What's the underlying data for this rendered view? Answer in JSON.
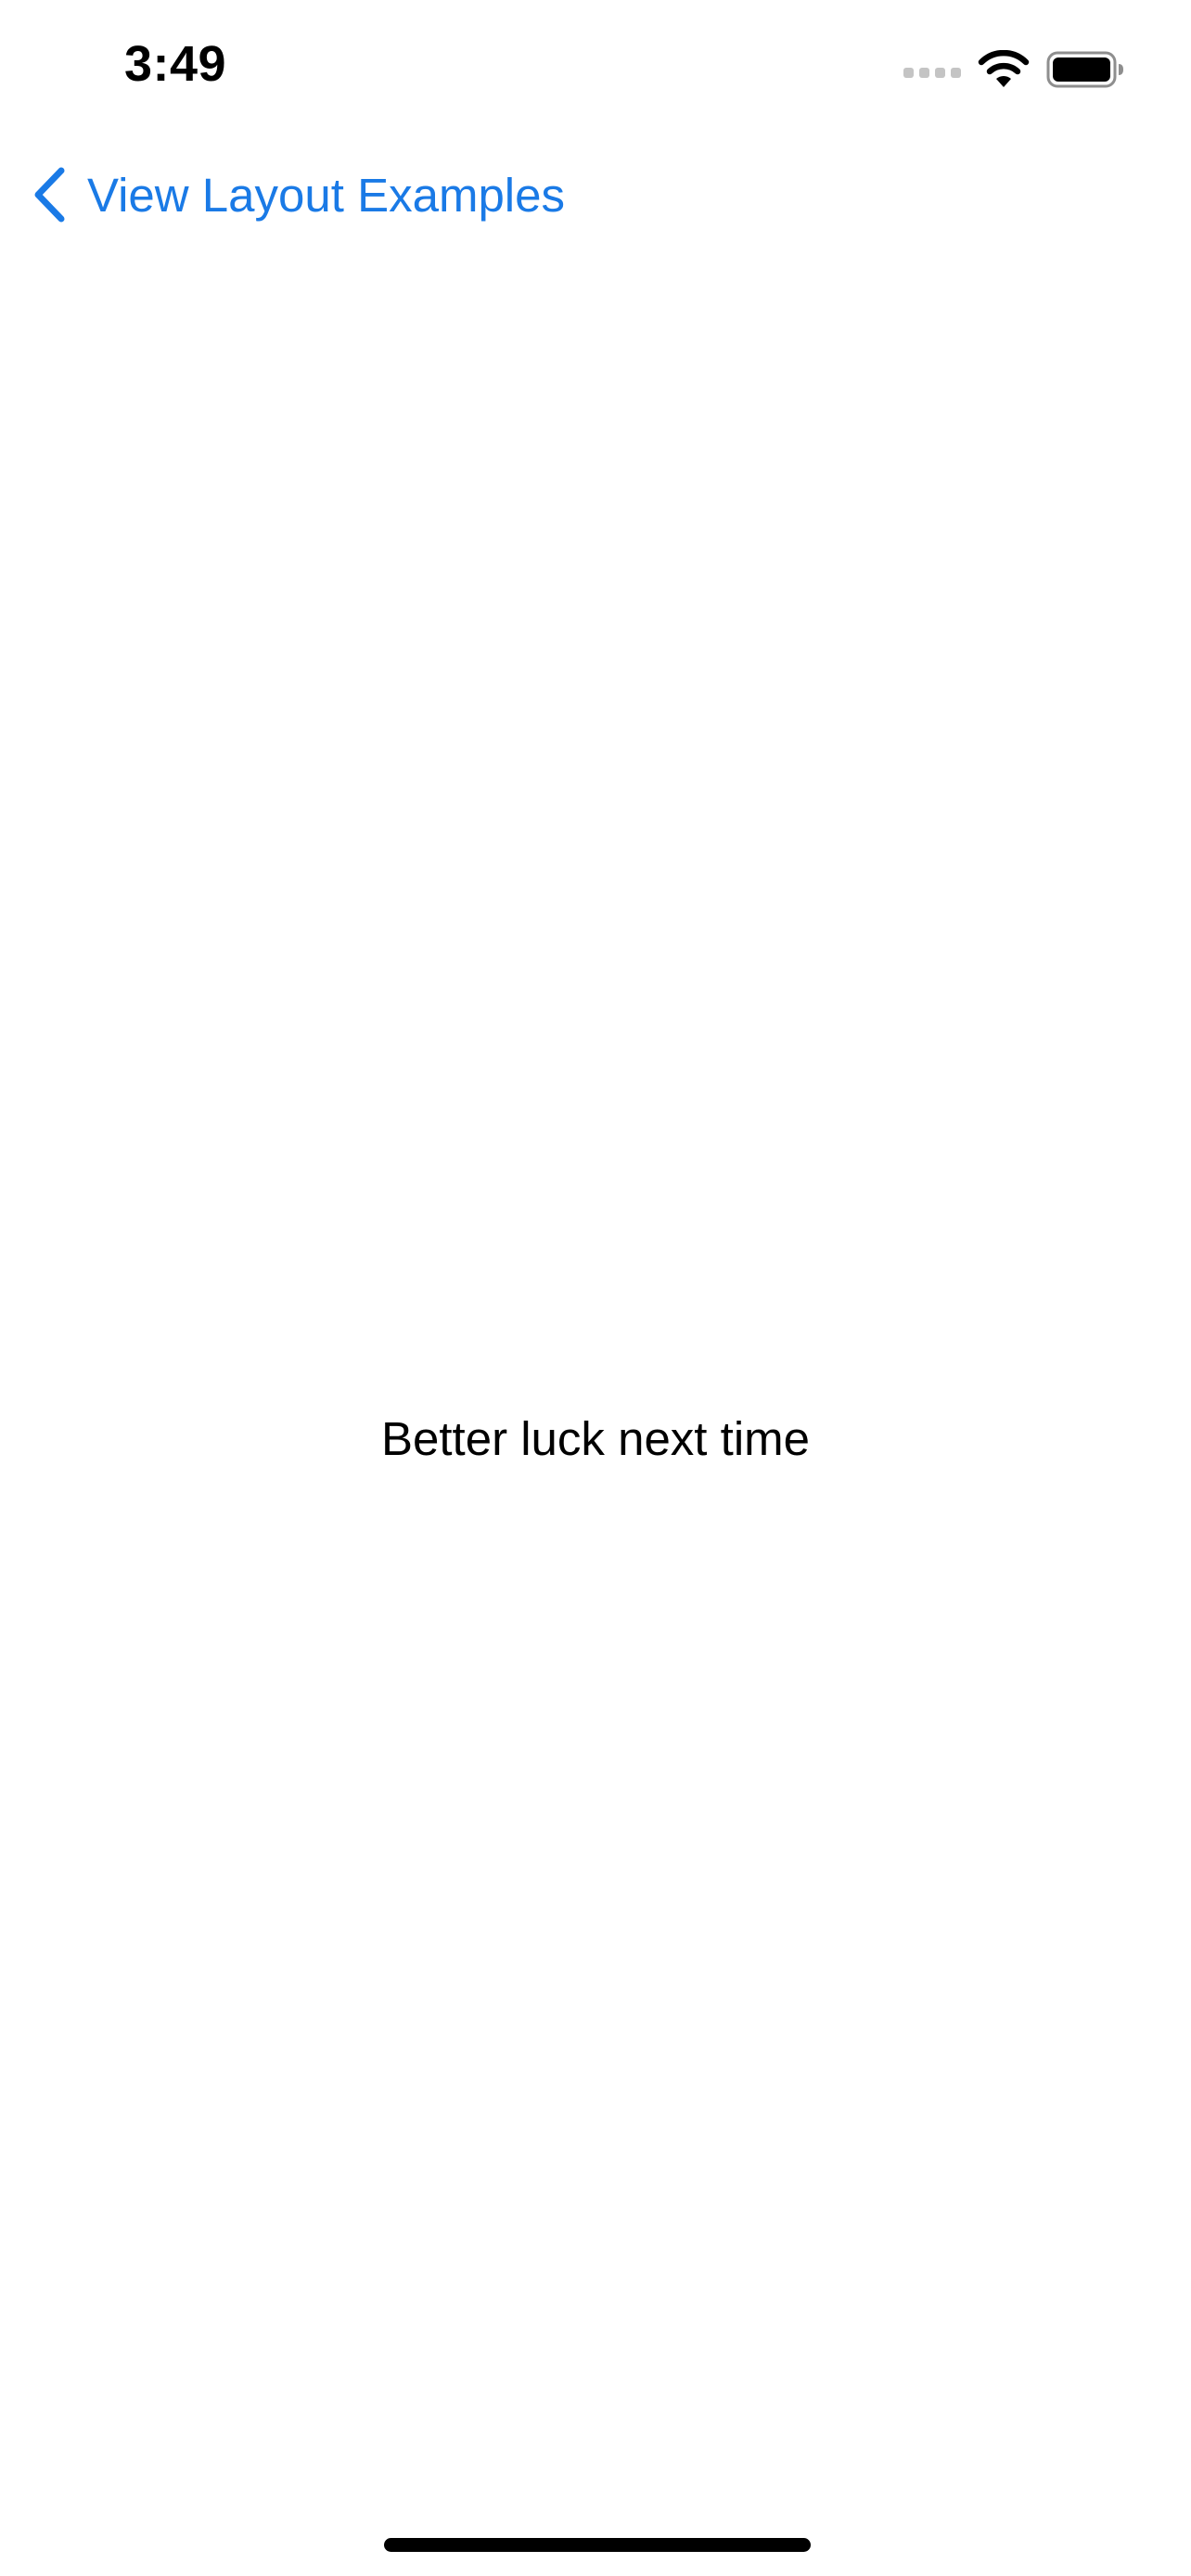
{
  "status_bar": {
    "time": "3:49",
    "icons": [
      "cellular-signal-icon",
      "wifi-icon",
      "battery-icon"
    ]
  },
  "nav": {
    "back_label": "View Layout Examples",
    "back_icon": "chevron-left-icon",
    "accent_color": "#1a7ae6"
  },
  "main": {
    "message": "Better luck next time"
  }
}
